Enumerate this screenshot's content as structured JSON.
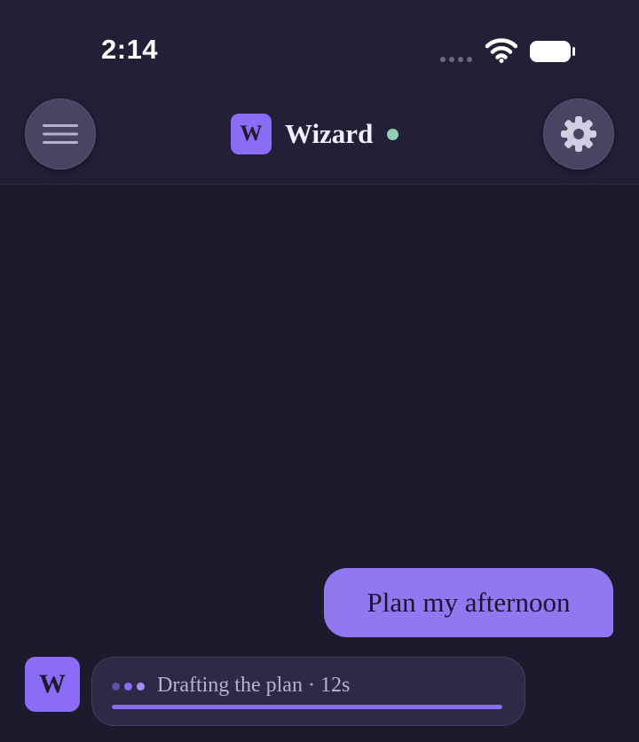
{
  "status_bar": {
    "time": "2:14"
  },
  "header": {
    "logo_letter": "W",
    "title": "Wizard",
    "online": true,
    "menu_icon": "hamburger-icon",
    "settings_icon": "gear-icon"
  },
  "messages": [
    {
      "role": "user",
      "text": "Plan my afternoon"
    }
  ],
  "assistant": {
    "avatar_letter": "W",
    "status_text": "Drafting the plan · 12s",
    "progress": 1.0
  },
  "colors": {
    "background": "#1e1a2e",
    "header": "#231f37",
    "accent": "#8b6cf6",
    "user_bubble": "#9178f0",
    "online": "#8fcfb3"
  }
}
